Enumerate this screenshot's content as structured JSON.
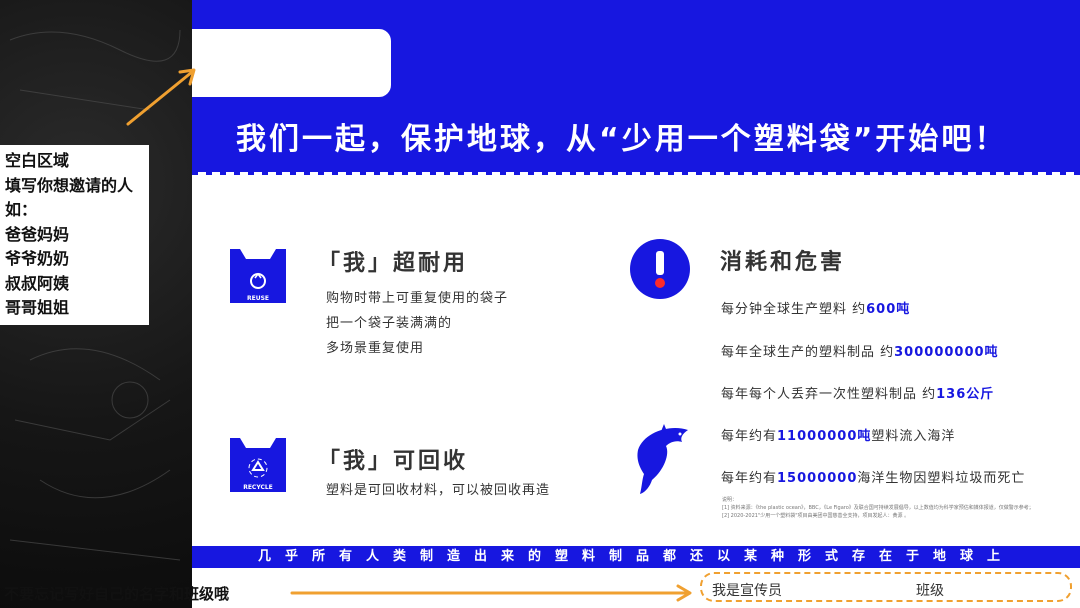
{
  "slide": {
    "headline": "我们一起，保护地球，从“少用一个塑料袋”开始吧！",
    "reuse": {
      "heading": "「我」超耐用",
      "bag_label": "REUSE",
      "lines": [
        "购物时带上可重复使用的袋子",
        "把一个袋子装满满的",
        "多场景重复使用"
      ]
    },
    "recycle": {
      "heading": "「我」可回收",
      "bag_label": "RECYCLE",
      "lines": [
        "塑料是可回收材料，可以被回收再造"
      ]
    },
    "harm": {
      "heading": "消耗和危害",
      "facts": [
        {
          "prefix": "每分钟全球生产塑料 约",
          "value": "600吨",
          "suffix": ""
        },
        {
          "prefix": "每年全球生产的塑料制品 约",
          "value": "300000000吨",
          "suffix": ""
        },
        {
          "prefix": "每年每个人丢弃一次性塑料制品 约",
          "value": "136公斤",
          "suffix": ""
        },
        {
          "prefix": "每年约有",
          "value": "11000000吨",
          "suffix": "塑料流入海洋"
        },
        {
          "prefix": "每年约有",
          "value": "15000000",
          "suffix": "海洋生物因塑料垃圾而死亡"
        }
      ],
      "notes": [
        "说明：",
        "[1] 资料来源：《the plastic ocean》，BBC，《Le Figaro》及联合国可持续发展倡导，以上数值均为科学家预估和媒体报道，仅做警示参考；",
        "[2] 2020-2021\"少用一个塑料袋\"项目由美团中国慈善全支持，项目发起人：黄源 。"
      ]
    },
    "bottom_bar": "几乎所有人类制造出来的塑料制品都还以某种形式存在于地球上",
    "name_box": {
      "name_label": "我是宣传员",
      "class_label": "班级"
    }
  },
  "annotations": {
    "blank_area_note": [
      "空白区域",
      "填写你想邀请的人",
      "如：",
      "爸爸妈妈",
      "爷爷奶奶",
      "叔叔阿姨",
      "哥哥姐姐"
    ],
    "name_hint": "不要忘记写好自己的名字和班级哦"
  },
  "colors": {
    "brand_blue": "#1717e0",
    "arrow_orange": "#f0a030",
    "text_dark": "#333333"
  },
  "icons": {
    "bag": "shopping-bag-icon",
    "recycle": "recycle-icon",
    "warning": "exclamation-icon",
    "dolphin": "dolphin-icon"
  }
}
